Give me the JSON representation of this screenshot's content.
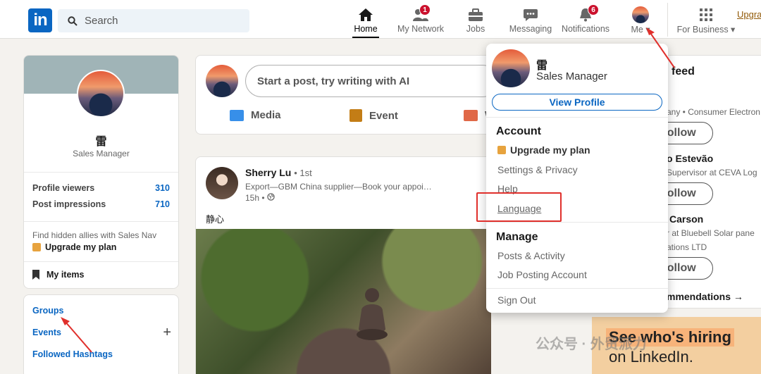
{
  "nav": {
    "logo": "in",
    "search_placeholder": "Search",
    "items": [
      {
        "label": "Home",
        "icon": "home-icon"
      },
      {
        "label": "My Network",
        "icon": "network-icon",
        "badge": "1"
      },
      {
        "label": "Jobs",
        "icon": "briefcase-icon"
      },
      {
        "label": "Messaging",
        "icon": "chat-icon"
      },
      {
        "label": "Notifications",
        "icon": "bell-icon",
        "badge": "6"
      },
      {
        "label": "Me ▾",
        "icon": "avatar"
      }
    ],
    "for_business": "For Business ▾",
    "upgrade": "Upgra"
  },
  "profile": {
    "name": "雷",
    "title": "Sales Manager",
    "stats": [
      {
        "label": "Profile viewers",
        "value": "310"
      },
      {
        "label": "Post impressions",
        "value": "710"
      }
    ],
    "hidden_allies": "Find hidden allies with Sales Nav",
    "upgrade_plan": "Upgrade my plan",
    "my_items": "My items"
  },
  "groups": {
    "links": [
      "Groups",
      "Events",
      "Followed Hashtags"
    ],
    "plus": "+"
  },
  "composer": {
    "placeholder": "Start a post, try writing with AI",
    "actions": [
      "Media",
      "Event",
      "W"
    ]
  },
  "post": {
    "author": "Sherry Lu",
    "degree": "• 1st",
    "headline": "Export—GBM China supplier—Book your appoi…",
    "time": "15h •",
    "text": "静心"
  },
  "right": {
    "feed": "feed",
    "rec1_sub": "any • Consumer Electron",
    "rec2_name": "o Estevão",
    "rec2_sub": "Supervisor at CEVA Log",
    "rec3_name": "Carson",
    "rec3_sub1": "r at Bluebell Solar pane",
    "rec3_sub2": "ations LTD",
    "follow": "Follow",
    "recommendations": "mmendations →",
    "ad_line1": "See who's hiring",
    "ad_line2": "on LinkedIn."
  },
  "dropdown": {
    "name": "雷",
    "title": "Sales Manager",
    "view_profile": "View Profile",
    "account_heading": "Account",
    "account_items": [
      "Upgrade my plan",
      "Settings & Privacy",
      "Help",
      "Language"
    ],
    "manage_heading": "Manage",
    "manage_items": [
      "Posts & Activity",
      "Job Posting Account"
    ],
    "sign_out": "Sign Out"
  },
  "watermark": "公众号 · 外贸派力",
  "colors": {
    "brand": "#0a66c2",
    "highlight": "#e0302c"
  }
}
